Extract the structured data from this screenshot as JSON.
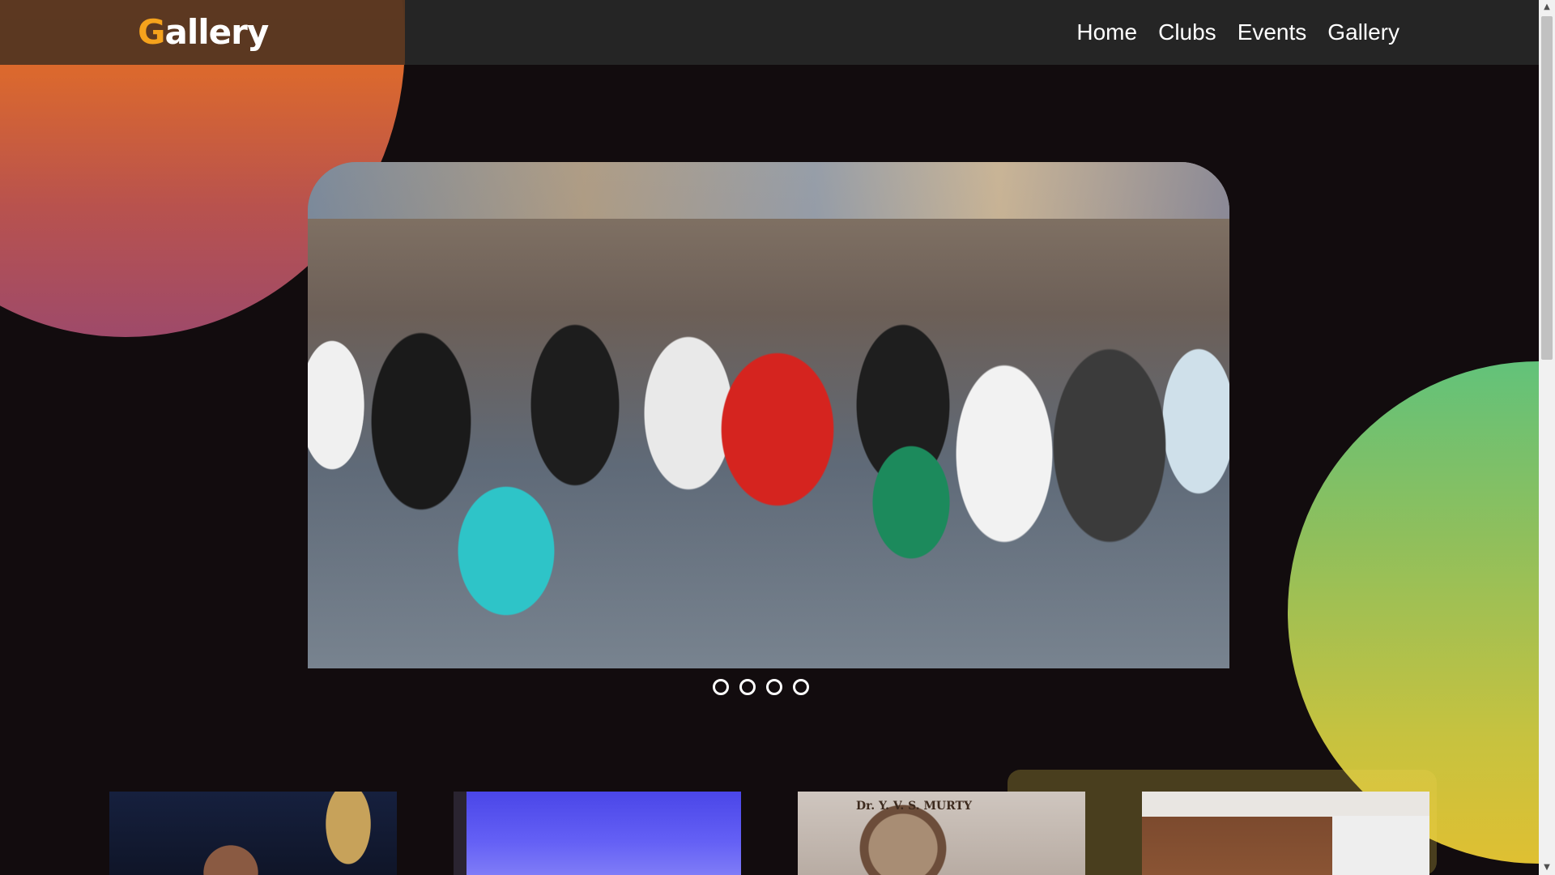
{
  "header": {
    "logo_first_letter": "G",
    "logo_rest": "allery",
    "nav": [
      "Home",
      "Clubs",
      "Events",
      "Gallery"
    ]
  },
  "carousel": {
    "slide_count": 4
  },
  "thumbnails": {
    "seal_text": "Dr. Y. V. S. MURTY"
  },
  "colors": {
    "logo_accent": "#f5a21c",
    "background": "#120c0e",
    "header": "#262626",
    "blob_orange": "#f07a12",
    "blob_green": "#62c27a"
  },
  "scrollbar": {
    "up_icon": "▲",
    "down_icon": "▼"
  }
}
